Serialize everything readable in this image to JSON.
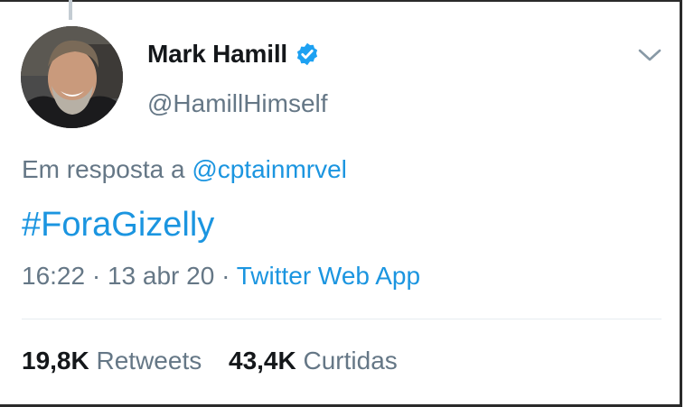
{
  "tweet": {
    "author_name": "Mark Hamill",
    "handle": "@HamillHimself",
    "reply_prefix": "Em resposta a",
    "reply_mention": "@cptainmrvel",
    "text": "#ForaGizelly",
    "time": "16:22",
    "date": "13 abr 20",
    "source": "Twitter Web App",
    "separator": "·",
    "retweets_count": "19,8K",
    "retweets_label": "Retweets",
    "likes_count": "43,4K",
    "likes_label": "Curtidas"
  },
  "icons": {
    "verified": "verified-badge-icon",
    "menu": "chevron-down-icon"
  },
  "colors": {
    "link": "#1b95e0",
    "secondary_text": "#657786",
    "primary_text": "#14171a",
    "verified": "#1da1f2"
  }
}
